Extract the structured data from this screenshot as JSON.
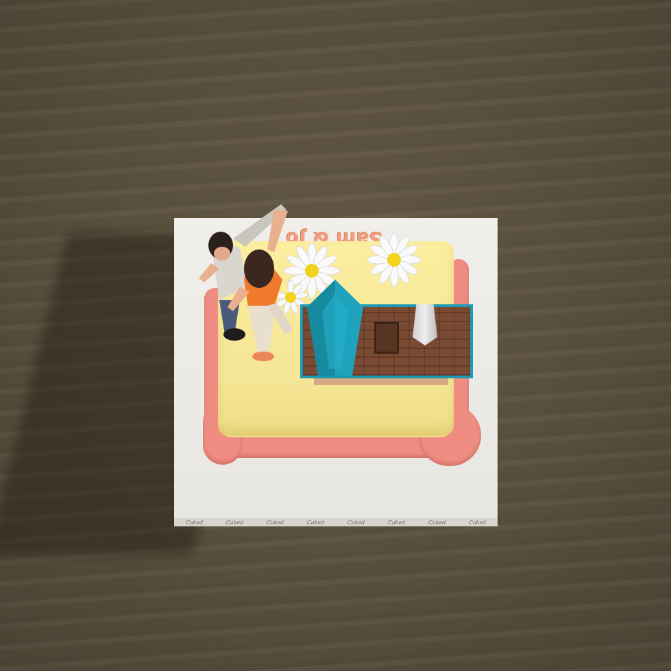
{
  "scene": {
    "description_type": "3d-cake-render",
    "board_inscription": "Sam & Jo",
    "board_edge_brand": "Caked",
    "board_edge_repeat": 8
  },
  "colors": {
    "floor": "#5d5440",
    "board": "#eeece8",
    "cake_top": "#fbee9e",
    "piping": "#ef8d82",
    "roof_trim": "#1d9bb3",
    "roof_shingles": "#7a4a33",
    "daisy_petal": "#ffffff",
    "daisy_center": "#f2d21b",
    "inscription": "#f0a07e"
  },
  "icons": [
    "daisy-icon",
    "house-topper-icon",
    "couple-figurine-icon"
  ]
}
